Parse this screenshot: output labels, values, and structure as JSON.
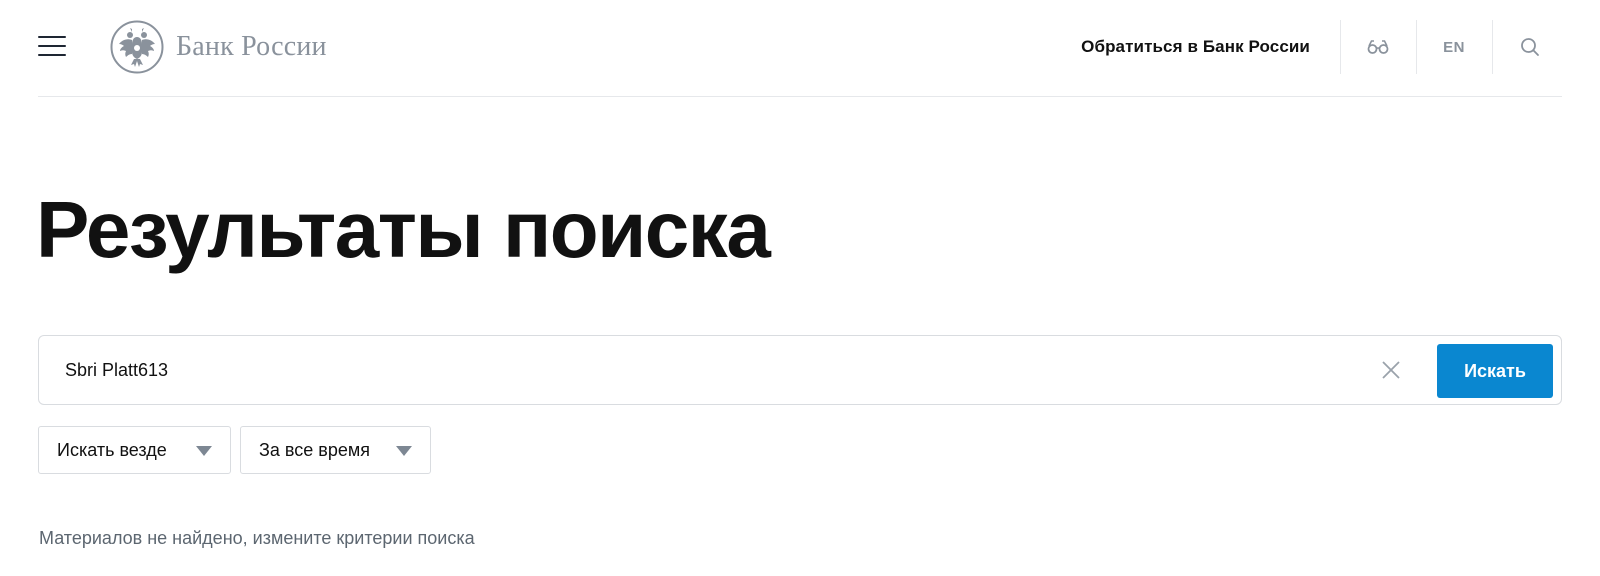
{
  "header": {
    "menu_icon": "hamburger-icon",
    "logo_text": "Банк России",
    "logo_icon": "double-headed-eagle-emblem",
    "contact_link": "Обратиться в Банк России",
    "accessibility_icon": "glasses-icon",
    "language": "EN",
    "search_icon": "search-icon"
  },
  "main": {
    "title": "Результаты поиска",
    "search": {
      "value": "Sbri Platt613",
      "clear_icon": "close-icon",
      "button_label": "Искать"
    },
    "filters": [
      {
        "label": "Искать везде",
        "icon": "caret-down-icon"
      },
      {
        "label": "За все время",
        "icon": "caret-down-icon"
      }
    ],
    "empty_message": "Материалов не найдено, измените критерии поиска"
  },
  "colors": {
    "accent": "#0a87d0",
    "logo_gray": "#8a929c",
    "border": "#d9dce0",
    "muted_text": "#5c6670"
  }
}
